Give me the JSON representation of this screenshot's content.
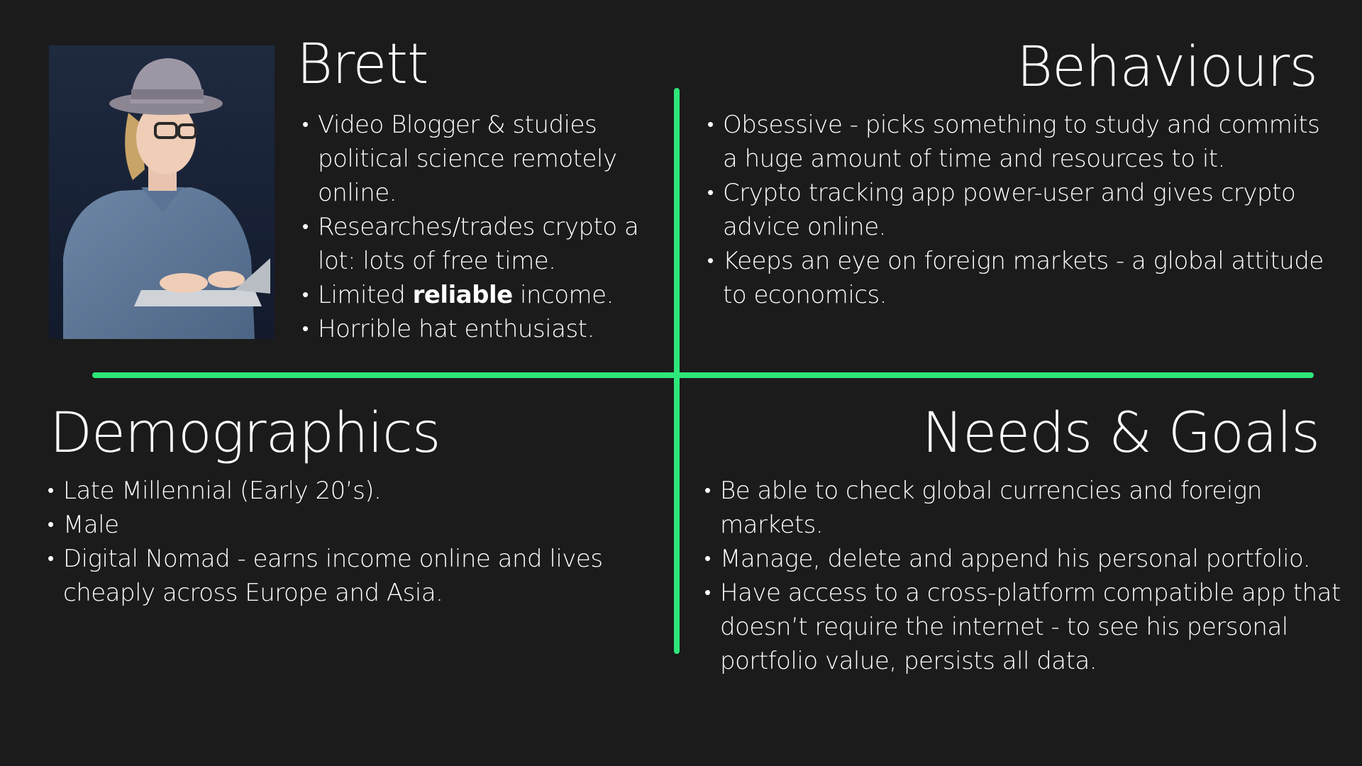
{
  "colors": {
    "background": "#1b1b1b",
    "accent": "#2ee67a",
    "text": "#ffffff"
  },
  "persona": {
    "name": "Brett",
    "photo_icon": "person-with-hat-and-laptop-photo",
    "bullets": {
      "b0": "Video Blogger & studies political science remotely online.",
      "b1": "Researches/trades crypto a lot: lots of free time.",
      "b2_pre": "Limited ",
      "b2_strong": "reliable",
      "b2_post": " income.",
      "b3": "Horrible hat enthusiast."
    }
  },
  "behaviours": {
    "title": "Behaviours",
    "items": [
      "Obsessive - picks something to study and commits a huge amount of time and resources to it.",
      "Crypto tracking app power-user and gives crypto advice online.",
      "Keeps an eye on foreign markets - a global attitude to economics."
    ]
  },
  "demographics": {
    "title": "Demographics",
    "items": [
      "Late Millennial (Early 20’s).",
      "Male",
      "Digital Nomad - earns income online and lives cheaply across Europe and Asia."
    ]
  },
  "needs_goals": {
    "title": "Needs & Goals",
    "items": [
      "Be able to check global currencies and foreign markets.",
      "Manage, delete and append his personal portfolio.",
      "Have access to a cross-platform compatible app that doesn’t require the internet - to see his personal portfolio value, persists all data."
    ]
  }
}
